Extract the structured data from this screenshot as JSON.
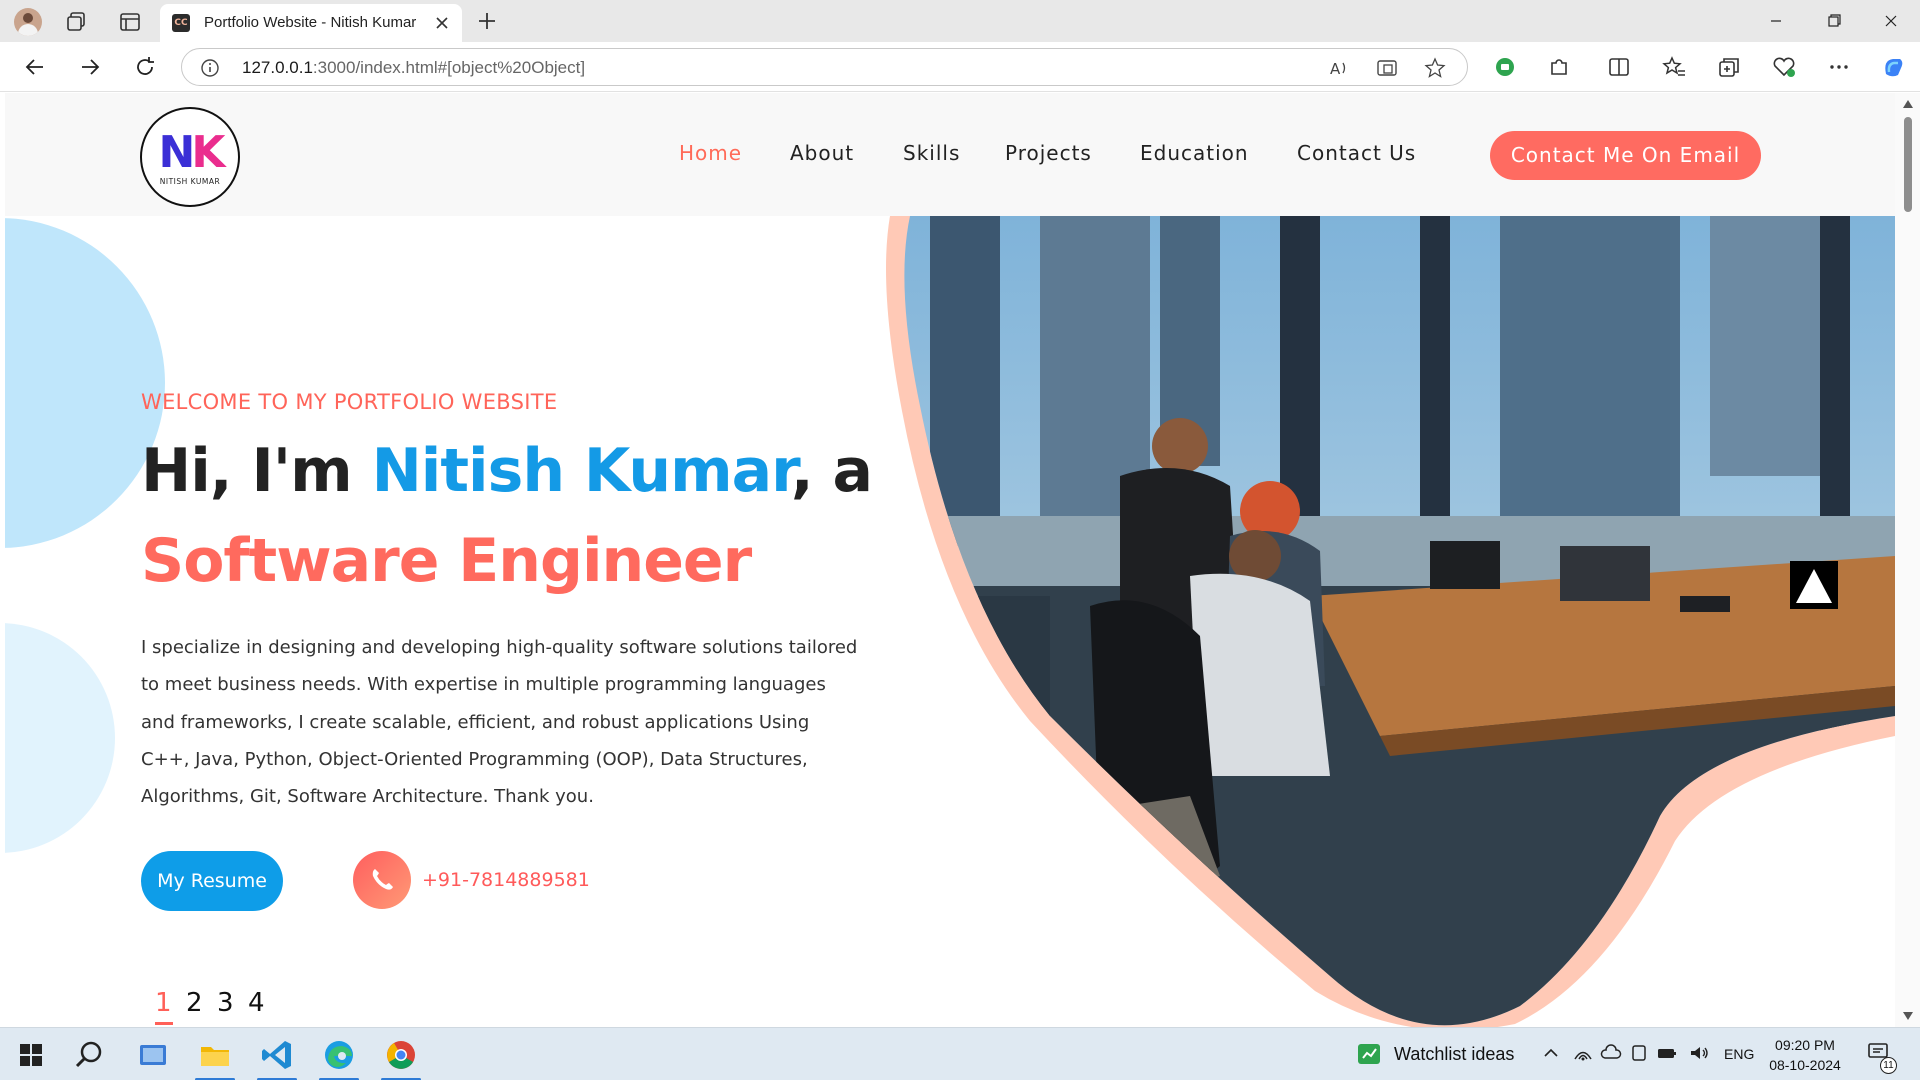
{
  "browser": {
    "tab_title": "Portfolio Website - Nitish Kumar",
    "tab_favicon_text": "CC",
    "url_host": "127.0.0.1",
    "url_rest": ":3000/index.html#[object%20Object]"
  },
  "site": {
    "logo_initials_n": "N",
    "logo_initials_k": "K",
    "logo_name": "NITISH KUMAR",
    "nav": [
      "Home",
      "About",
      "Skills",
      "Projects",
      "Education",
      "Contact Us"
    ],
    "active_nav": "Home",
    "cta_label": "Contact Me On Email",
    "welcome": "WELCOME TO MY PORTFOLIO WEBSITE",
    "greeting_prefix": "Hi, I'm ",
    "name": "Nitish Kumar",
    "greeting_suffix": ", a",
    "role": "Software Engineer",
    "bio": "I specialize in designing and developing high-quality software solutions tailored to meet business needs. With expertise in multiple programming languages and frameworks, I create scalable, efficient, and robust applications Using C++, Java, Python, Object-Oriented Programming (OOP), Data Structures, Algorithms, Git, Software Architecture. Thank you.",
    "resume_label": "My Resume",
    "phone": "+91-7814889581",
    "pager": [
      "1",
      "2",
      "3",
      "4"
    ],
    "pager_active": "1",
    "colors": {
      "accent": "#ff6a5e",
      "blue": "#149ae6",
      "cta": "#ff6b61"
    }
  },
  "taskbar": {
    "widget_text": "Watchlist ideas",
    "language": "ENG",
    "time": "09:20 PM",
    "date": "08-10-2024",
    "notification_count": "11"
  }
}
